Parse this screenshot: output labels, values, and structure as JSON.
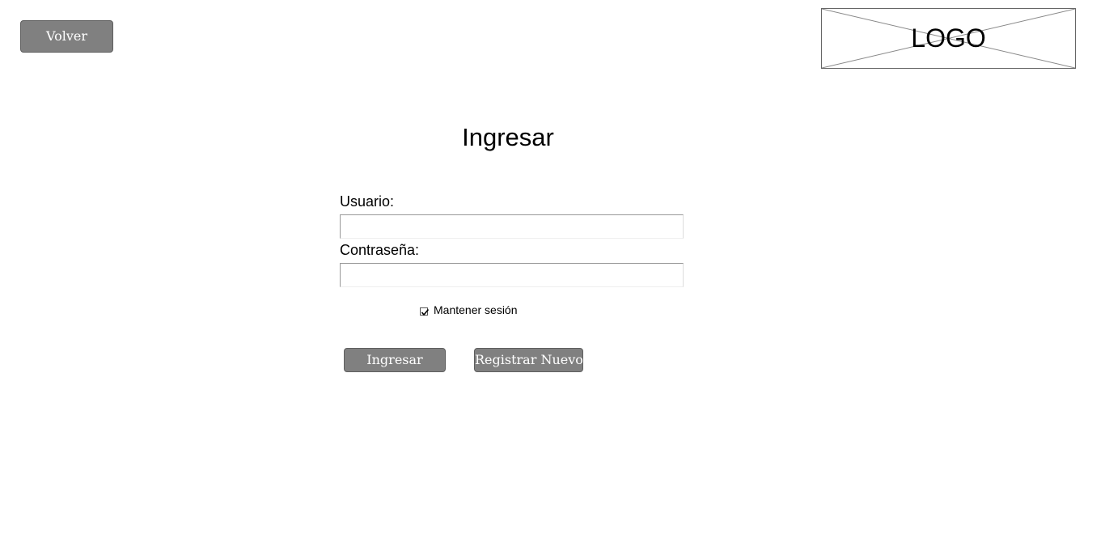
{
  "header": {
    "back_label": "Volver",
    "logo_text": "LOGO"
  },
  "form": {
    "title": "Ingresar",
    "user_label": "Usuario:",
    "user_value": "",
    "password_label": "Contraseña:",
    "password_value": "",
    "remember_label": "Mantener sesión",
    "remember_checked": true,
    "submit_label": "Ingresar",
    "register_label": "Registrar Nuevo"
  },
  "colors": {
    "button_bg": "#808080",
    "button_text": "#ffffff"
  }
}
